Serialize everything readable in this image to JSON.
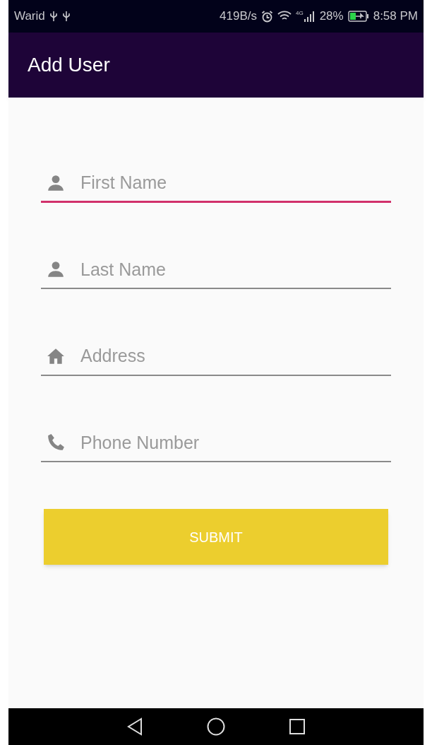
{
  "status_bar": {
    "carrier": "Warid",
    "speed": "419B/s",
    "network": "4G",
    "battery": "28%",
    "time": "8:58 PM"
  },
  "app_bar": {
    "title": "Add User"
  },
  "fields": [
    {
      "kind": "person",
      "placeholder": "First Name",
      "focused": true
    },
    {
      "kind": "person",
      "placeholder": "Last Name",
      "focused": false
    },
    {
      "kind": "home",
      "placeholder": "Address",
      "focused": false
    },
    {
      "kind": "phone",
      "placeholder": "Phone Number",
      "focused": false
    }
  ],
  "submit_button": {
    "label": "SUBMIT"
  }
}
